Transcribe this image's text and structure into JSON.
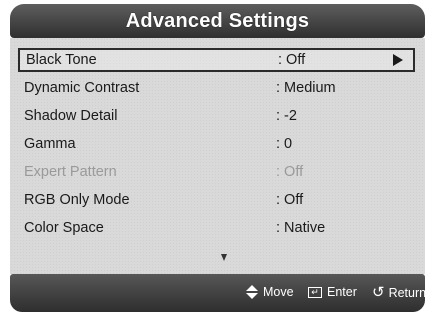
{
  "title": "Advanced Settings",
  "settings": [
    {
      "label": "Black Tone",
      "value": ": Off",
      "selected": true,
      "disabled": false
    },
    {
      "label": "Dynamic Contrast",
      "value": ": Medium",
      "selected": false,
      "disabled": false
    },
    {
      "label": "Shadow Detail",
      "value": ": -2",
      "selected": false,
      "disabled": false
    },
    {
      "label": "Gamma",
      "value": ": 0",
      "selected": false,
      "disabled": false
    },
    {
      "label": "Expert Pattern",
      "value": ": Off",
      "selected": false,
      "disabled": true
    },
    {
      "label": "RGB Only Mode",
      "value": ": Off",
      "selected": false,
      "disabled": false
    },
    {
      "label": "Color Space",
      "value": ": Native",
      "selected": false,
      "disabled": false
    }
  ],
  "footer": {
    "move_label": "Move",
    "enter_label": "Enter",
    "return_label": "Return"
  },
  "icons": {
    "submenu": "right-arrow-icon",
    "scroll": "scroll-down-icon",
    "move": "up-down-arrows-icon",
    "enter": "enter-icon",
    "return": "return-icon"
  }
}
